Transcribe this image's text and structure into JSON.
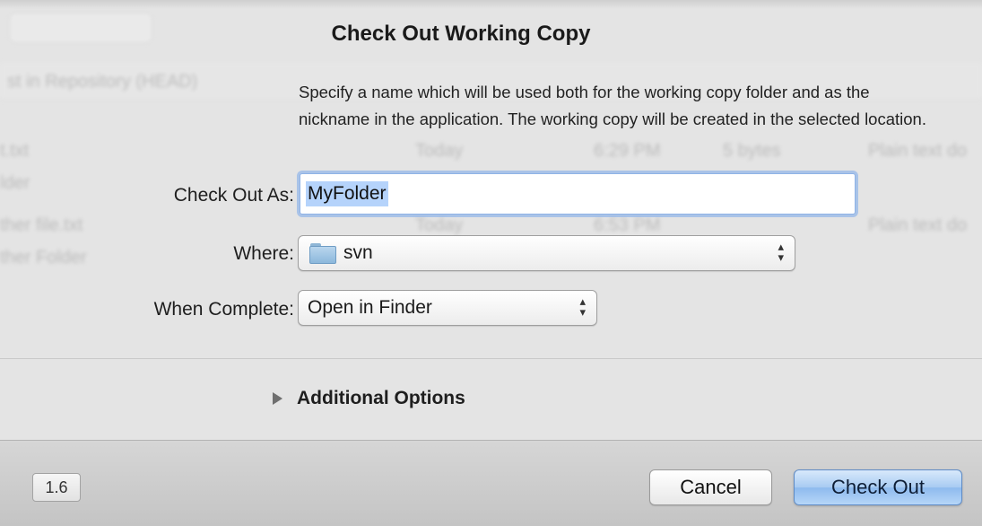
{
  "dialog": {
    "title": "Check Out Working Copy",
    "description": "Specify a name which will be used both for the working copy folder and as the nickname in the application. The working copy will be created in the selected location."
  },
  "form": {
    "checkout_as": {
      "label": "Check Out As:",
      "value": "MyFolder"
    },
    "where": {
      "label": "Where:",
      "value": "svn",
      "icon": "folder-icon"
    },
    "when_complete": {
      "label": "When Complete:",
      "value": "Open in Finder"
    }
  },
  "additional_options": {
    "label": "Additional Options",
    "expanded": false
  },
  "footer": {
    "version": "1.6",
    "cancel_label": "Cancel",
    "checkout_label": "Check Out"
  },
  "background_window": {
    "toolbar_item": "st in Repository (HEAD)",
    "rows": [
      {
        "name": "t.txt",
        "date": "Today",
        "time": "6:29 PM",
        "size": "5 bytes",
        "kind": "Plain text do"
      },
      {
        "name": "lder",
        "date": "",
        "time": "",
        "size": "",
        "kind": ""
      },
      {
        "name": "ther file.txt",
        "date": "Today",
        "time": "6:53 PM",
        "size": "",
        "kind": "Plain text do"
      },
      {
        "name": "ther Folder",
        "date": "",
        "time": "",
        "size": "",
        "kind": ""
      }
    ]
  },
  "colors": {
    "sheet_bg": "#e4e4e4",
    "footer_bg": "#cbcbcb",
    "focus_ring": "#78a8eb",
    "default_button": "#a8cbf2",
    "selection": "#b5d3fb"
  }
}
